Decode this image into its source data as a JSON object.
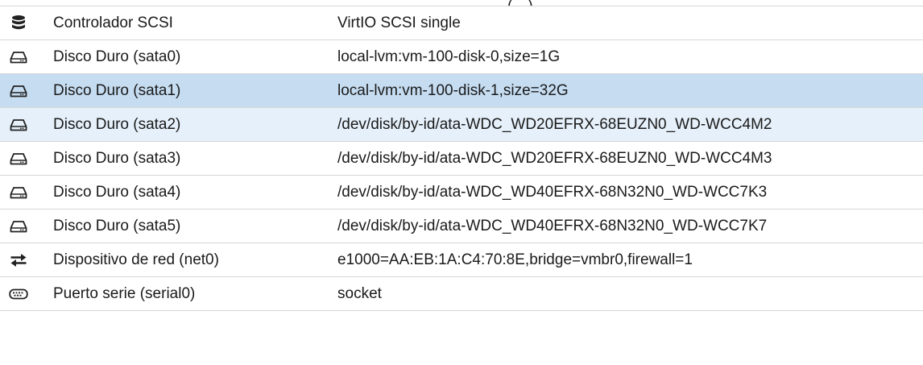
{
  "hardware": {
    "rows": [
      {
        "name": "",
        "value": "(…)",
        "icon": "partial-icon",
        "state": ""
      },
      {
        "name": "Controlador SCSI",
        "value": "VirtIO SCSI single",
        "icon": "database-icon",
        "state": ""
      },
      {
        "name": "Disco Duro (sata0)",
        "value": "local-lvm:vm-100-disk-0,size=1G",
        "icon": "hard-disk-icon",
        "state": ""
      },
      {
        "name": "Disco Duro (sata1)",
        "value": "local-lvm:vm-100-disk-1,size=32G",
        "icon": "hard-disk-icon",
        "state": "selected"
      },
      {
        "name": "Disco Duro (sata2)",
        "value": "/dev/disk/by-id/ata-WDC_WD20EFRX-68EUZN0_WD-WCC4M2",
        "icon": "hard-disk-icon",
        "state": "hover"
      },
      {
        "name": "Disco Duro (sata3)",
        "value": "/dev/disk/by-id/ata-WDC_WD20EFRX-68EUZN0_WD-WCC4M3",
        "icon": "hard-disk-icon",
        "state": ""
      },
      {
        "name": "Disco Duro (sata4)",
        "value": "/dev/disk/by-id/ata-WDC_WD40EFRX-68N32N0_WD-WCC7K3",
        "icon": "hard-disk-icon",
        "state": ""
      },
      {
        "name": "Disco Duro (sata5)",
        "value": "/dev/disk/by-id/ata-WDC_WD40EFRX-68N32N0_WD-WCC7K7",
        "icon": "hard-disk-icon",
        "state": ""
      },
      {
        "name": "Dispositivo de red (net0)",
        "value": "e1000=AA:EB:1A:C4:70:8E,bridge=vmbr0,firewall=1",
        "icon": "exchange-arrows-icon",
        "state": ""
      },
      {
        "name": "Puerto serie (serial0)",
        "value": "socket",
        "icon": "keyboard-icon",
        "state": ""
      }
    ]
  },
  "colors": {
    "selected_row": "#c5dcf1",
    "hover_row": "#e6f0fa",
    "separator": "#d6d6d6",
    "text": "#1a1a1a"
  }
}
